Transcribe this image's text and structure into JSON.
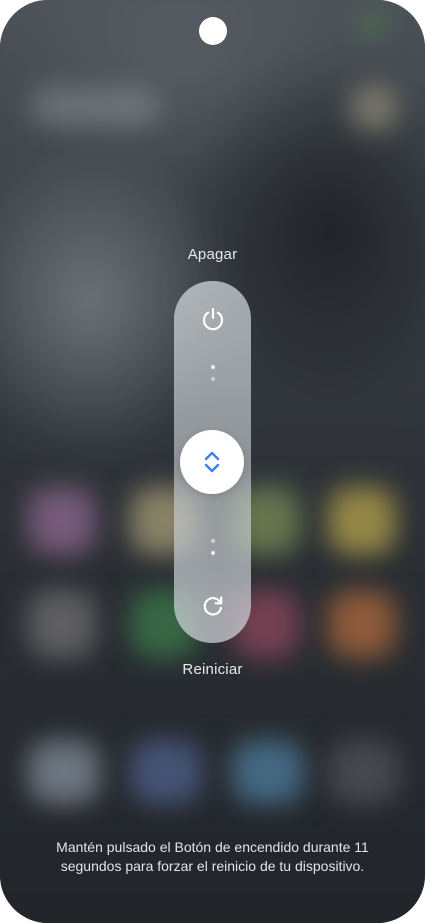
{
  "power_menu": {
    "power_off_label": "Apagar",
    "restart_label": "Reiniciar",
    "hint_text": "Mantén pulsado el Botón de encendido durante 11 segundos para forzar el reinicio de tu dispositivo.",
    "icons": {
      "power": "power-icon",
      "handle": "chevron-up-down-icon",
      "restart": "restart-icon"
    }
  },
  "colors": {
    "accent": "#3d7ef0",
    "text": "#e6e8ea",
    "slider_track": "#d3d8dc",
    "knob": "#ffffff"
  }
}
